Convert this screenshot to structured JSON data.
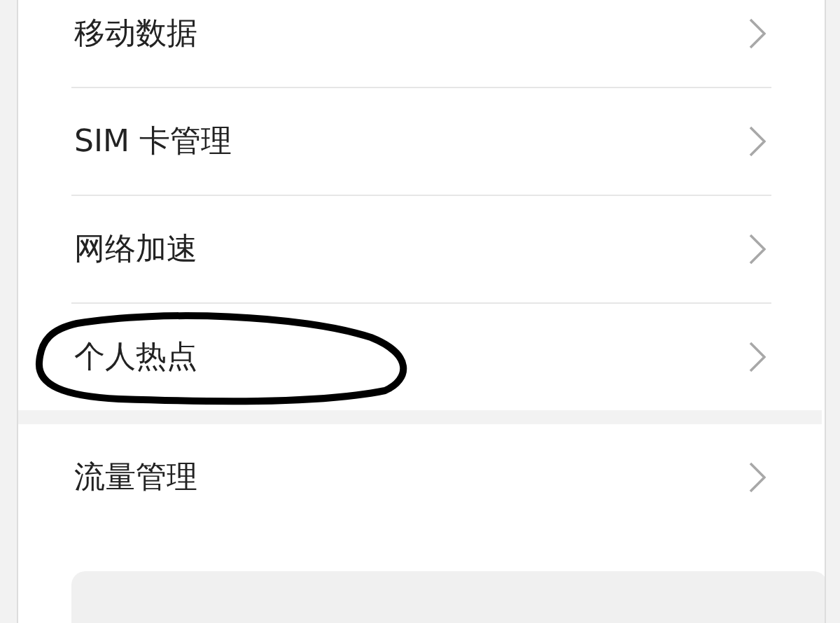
{
  "groups": [
    {
      "items": [
        {
          "label": "移动数据",
          "circled": false
        },
        {
          "label": "SIM 卡管理",
          "circled": false
        },
        {
          "label": "网络加速",
          "circled": false
        },
        {
          "label": "个人热点",
          "circled": true
        }
      ]
    },
    {
      "items": [
        {
          "label": "流量管理",
          "circled": false
        }
      ]
    }
  ]
}
